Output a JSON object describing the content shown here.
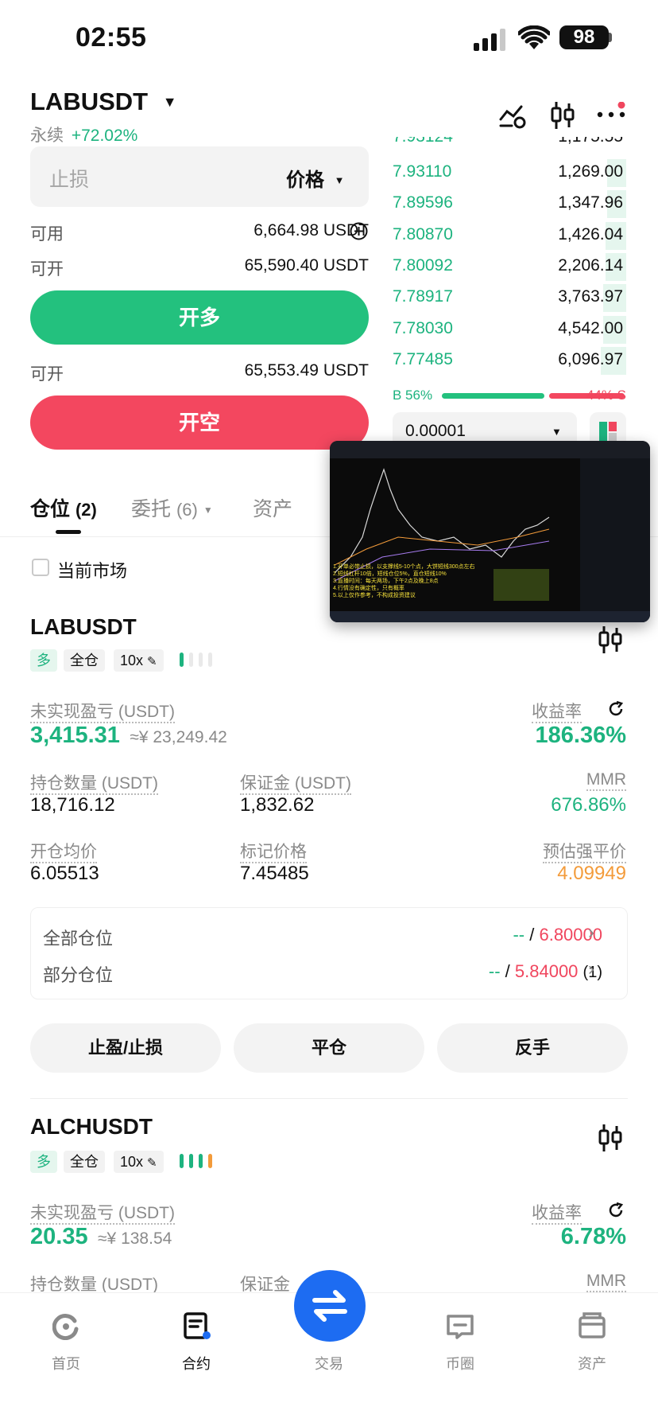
{
  "status_bar": {
    "time": "02:55",
    "battery": "98"
  },
  "header": {
    "pair": "LABUSDT",
    "type": "永续",
    "change": "+72.02%"
  },
  "order_form": {
    "stop_label": "止损",
    "price_type": "价格",
    "available_label": "可用",
    "available_value": "6,664.98 USDT",
    "open_label": "可开",
    "open_long_value": "65,590.40 USDT",
    "long_button": "开多",
    "open_short_value": "65,553.49 USDT",
    "short_button": "开空"
  },
  "orderbook": {
    "rows": [
      {
        "price": "7.93110",
        "qty": "1,269.00",
        "depth": 0.08
      },
      {
        "price": "7.89596",
        "qty": "1,347.96",
        "depth": 0.08
      },
      {
        "price": "7.80870",
        "qty": "1,426.04",
        "depth": 0.09
      },
      {
        "price": "7.80092",
        "qty": "2,206.14",
        "depth": 0.09
      },
      {
        "price": "7.78917",
        "qty": "3,763.97",
        "depth": 0.1
      },
      {
        "price": "7.78030",
        "qty": "4,542.00",
        "depth": 0.1
      },
      {
        "price": "7.77485",
        "qty": "6,096.97",
        "depth": 0.11
      }
    ],
    "buy_label": "B 56%",
    "sell_label": "44% S",
    "buy_ratio": 0.56,
    "precision": "0.00001"
  },
  "tabs": [
    {
      "label": "仓位",
      "count": "(2)"
    },
    {
      "label": "委托",
      "count": "(6)"
    },
    {
      "label": "资产",
      "count": ""
    }
  ],
  "filter_label": "当前市场",
  "positions": [
    {
      "symbol": "LABUSDT",
      "side": "多",
      "margin_mode": "全仓",
      "leverage": "10x",
      "pnl_label": "未实现盈亏 (USDT)",
      "pnl": "3,415.31",
      "pnl_cny": "≈¥ 23,249.42",
      "roe_label": "收益率",
      "roe": "186.36%",
      "size_label": "持仓数量 (USDT)",
      "size": "18,716.12",
      "margin_label": "保证金 (USDT)",
      "margin": "1,832.62",
      "mmr_label": "MMR",
      "mmr": "676.86%",
      "entry_label": "开仓均价",
      "entry": "6.05513",
      "mark_label": "标记价格",
      "mark": "7.45485",
      "liq_label": "预估强平价",
      "liq": "4.09949",
      "tpsl_all_label": "全部仓位",
      "tpsl_all_tp": "--",
      "tpsl_all_sl": "6.80000",
      "tpsl_part_label": "部分仓位",
      "tpsl_part_tp": "--",
      "tpsl_part_sl": "5.84000",
      "tpsl_part_count": "(1)",
      "actions": [
        "止盈/止损",
        "平仓",
        "反手"
      ]
    },
    {
      "symbol": "ALCHUSDT",
      "side": "多",
      "margin_mode": "全仓",
      "leverage": "10x",
      "pnl_label": "未实现盈亏 (USDT)",
      "pnl": "20.35",
      "pnl_cny": "≈¥ 138.54",
      "roe_label": "收益率",
      "roe": "6.78%",
      "size_label": "持仓数量 (USDT)",
      "margin_label": "保证金",
      "mmr_label": "MMR"
    }
  ],
  "nav": [
    {
      "label": "首页",
      "icon": "home-icon"
    },
    {
      "label": "合约",
      "icon": "contract-icon"
    },
    {
      "label": "交易",
      "icon": "swap-icon"
    },
    {
      "label": "币圈",
      "icon": "community-icon"
    },
    {
      "label": "资产",
      "icon": "wallet-icon"
    }
  ],
  "video_overlay": {
    "caption_lines": [
      "1.开单必带止损，以支撑线5-10个点，大饼短线300点左右",
      "2.短线杠杆10倍，短线仓位5%，直仓短线10%",
      "3.直播时间：每天两场，下午2点及晚上8点",
      "4.行情没有确定性，只有概率",
      "5.以上仅作参考，不构成投资建议"
    ]
  },
  "colors": {
    "green": "#1db37f",
    "red": "#f0465e",
    "orange": "#f39b3a",
    "blue": "#1d6cf2"
  }
}
